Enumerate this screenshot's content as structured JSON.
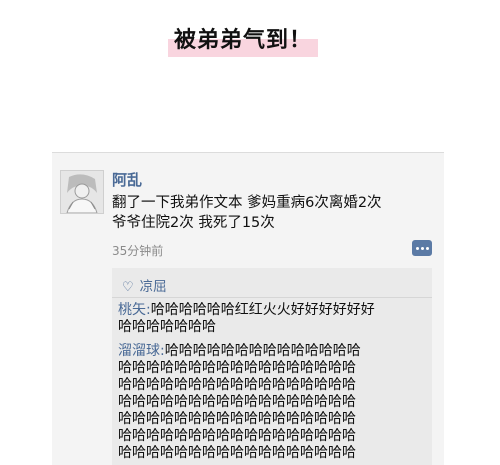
{
  "banner": {
    "headline": "被弟弟气到！"
  },
  "post": {
    "username": "阿乱",
    "text_lines": [
      "翻了一下我弟作文本 爹妈重病6次离婚2次",
      "爷爷住院2次 我死了15次"
    ],
    "time": "35分钟前"
  },
  "likes": {
    "icon": "heart-icon",
    "names": "凉屈"
  },
  "comments": [
    {
      "author": "桃矢:",
      "lines": [
        "哈哈哈哈哈哈红红火火好好好好好好",
        "哈哈哈哈哈哈哈"
      ]
    },
    {
      "author": "溜溜球:",
      "lines": [
        "哈哈哈哈哈哈哈哈哈哈哈哈哈哈",
        "哈哈哈哈哈哈哈哈哈哈哈哈哈哈哈哈哈",
        "哈哈哈哈哈哈哈哈哈哈哈哈哈哈哈哈哈",
        "哈哈哈哈哈哈哈哈哈哈哈哈哈哈哈哈哈",
        "哈哈哈哈哈哈哈哈哈哈哈哈哈哈哈哈哈",
        "哈哈哈哈哈哈哈哈哈哈哈哈哈哈哈哈哈",
        "哈哈哈哈哈哈哈哈哈哈哈哈哈哈哈哈哈"
      ]
    }
  ]
}
